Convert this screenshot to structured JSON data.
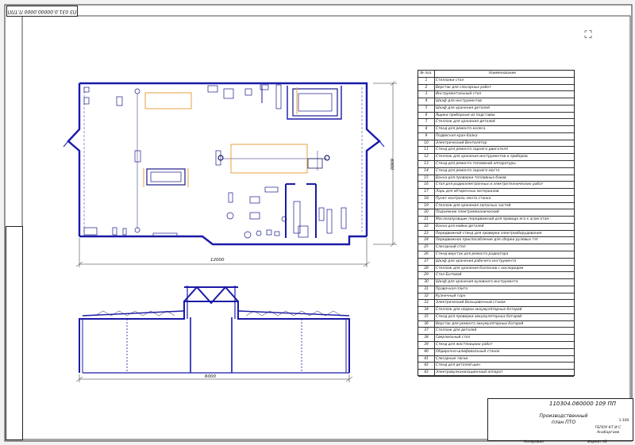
{
  "stamp_code": "ПЗ 031.0.00000.0000 П.ТПП",
  "viewer": {
    "fullscreen_icon": "fullscreen-icon"
  },
  "dimensions": {
    "plan_width": "12000",
    "plan_height": "6000",
    "section_width": "6000"
  },
  "legend": {
    "header_num": "№ поз.",
    "header_name": "Наименование",
    "rows": [
      {
        "num": "1",
        "name": "Стеллажи стол"
      },
      {
        "num": "2",
        "name": "Верстак для слесарных работ"
      },
      {
        "num": "3",
        "name": "Инструментальный стол"
      },
      {
        "num": "4",
        "name": "Шкаф для инструментов"
      },
      {
        "num": "5",
        "name": "Шкаф для хранения деталей"
      },
      {
        "num": "6",
        "name": "Ящики приборные из подставок"
      },
      {
        "num": "7",
        "name": "Стеллаж для хранения деталей"
      },
      {
        "num": "8",
        "name": "Стенд для ремонта колеса"
      },
      {
        "num": "9",
        "name": "Подвесная кран-балка"
      },
      {
        "num": "10",
        "name": "Электрический Вентилятор"
      },
      {
        "num": "11",
        "name": "Стенд для ремонта заднего двигателя"
      },
      {
        "num": "12",
        "name": "Стеллаж для хранения инструментов и приборов"
      },
      {
        "num": "13",
        "name": "Стенд для ремонта топливной аппаратуры"
      },
      {
        "num": "14",
        "name": "Стенд для ремонта заднего моста"
      },
      {
        "num": "15",
        "name": "Ванна для проверки топливных баков"
      },
      {
        "num": "16",
        "name": "Стол для радиоэлектронных и электротехнических работ"
      },
      {
        "num": "17",
        "name": "Ларь для обтирочных материалов"
      },
      {
        "num": "18",
        "name": "Пункт контроль-лента станка"
      },
      {
        "num": "19",
        "name": "Стеллаж для хранения запасных частей"
      },
      {
        "num": "20",
        "name": "Подъемник электромеханический"
      },
      {
        "num": "21",
        "name": "Маслозаправщик передвижной для привода его к агрегатам"
      },
      {
        "num": "22",
        "name": "Ванна для мойки деталей"
      },
      {
        "num": "23",
        "name": "Передвижной стенд для проверки электрооборудования"
      },
      {
        "num": "24",
        "name": "Передвижное приспособление для сборки рулевых тяг"
      },
      {
        "num": "25",
        "name": "Слесарный стол"
      },
      {
        "num": "26",
        "name": "Стенд-верстак для ремонта радиатора"
      },
      {
        "num": "27",
        "name": "Шкаф для хранения рабочего инструмента"
      },
      {
        "num": "28",
        "name": "Стеллаж для хранения баллонов с кислородом"
      },
      {
        "num": "29",
        "name": "Стол Бытовой"
      },
      {
        "num": "30",
        "name": "Шкаф для хранения кузовного инструмента"
      },
      {
        "num": "31",
        "name": "Правочная плита"
      },
      {
        "num": "32",
        "name": "Кузнечный горн"
      },
      {
        "num": "33",
        "name": "Электрический Вальцовочный станок"
      },
      {
        "num": "34",
        "name": "Стеллаж для сварки аккумуляторных батарей"
      },
      {
        "num": "35",
        "name": "Стенд для проверки аккумуляторных батарей"
      },
      {
        "num": "36",
        "name": "Верстак для ремонта аккумуляторных батарей"
      },
      {
        "num": "37",
        "name": "Стеллаж для деталей"
      },
      {
        "num": "38",
        "name": "Сверлильный стол"
      },
      {
        "num": "39",
        "name": "Стенд для жестяницких работ"
      },
      {
        "num": "40",
        "name": "Обдирочно-шлифовальный станок"
      },
      {
        "num": "41",
        "name": "Слесарные тиски"
      },
      {
        "num": "42",
        "name": "Стенд для деталей шин"
      },
      {
        "num": "43",
        "name": "Электровулканизационный аппарат"
      }
    ]
  },
  "title_block": {
    "code": "110304.060000 109 ПП",
    "title": "Производственный план ПТО",
    "org": "ГБПОУ КТ И С Анабаргаев",
    "scale": "1:100",
    "format": "Формат А1",
    "copied": "Копировал"
  }
}
